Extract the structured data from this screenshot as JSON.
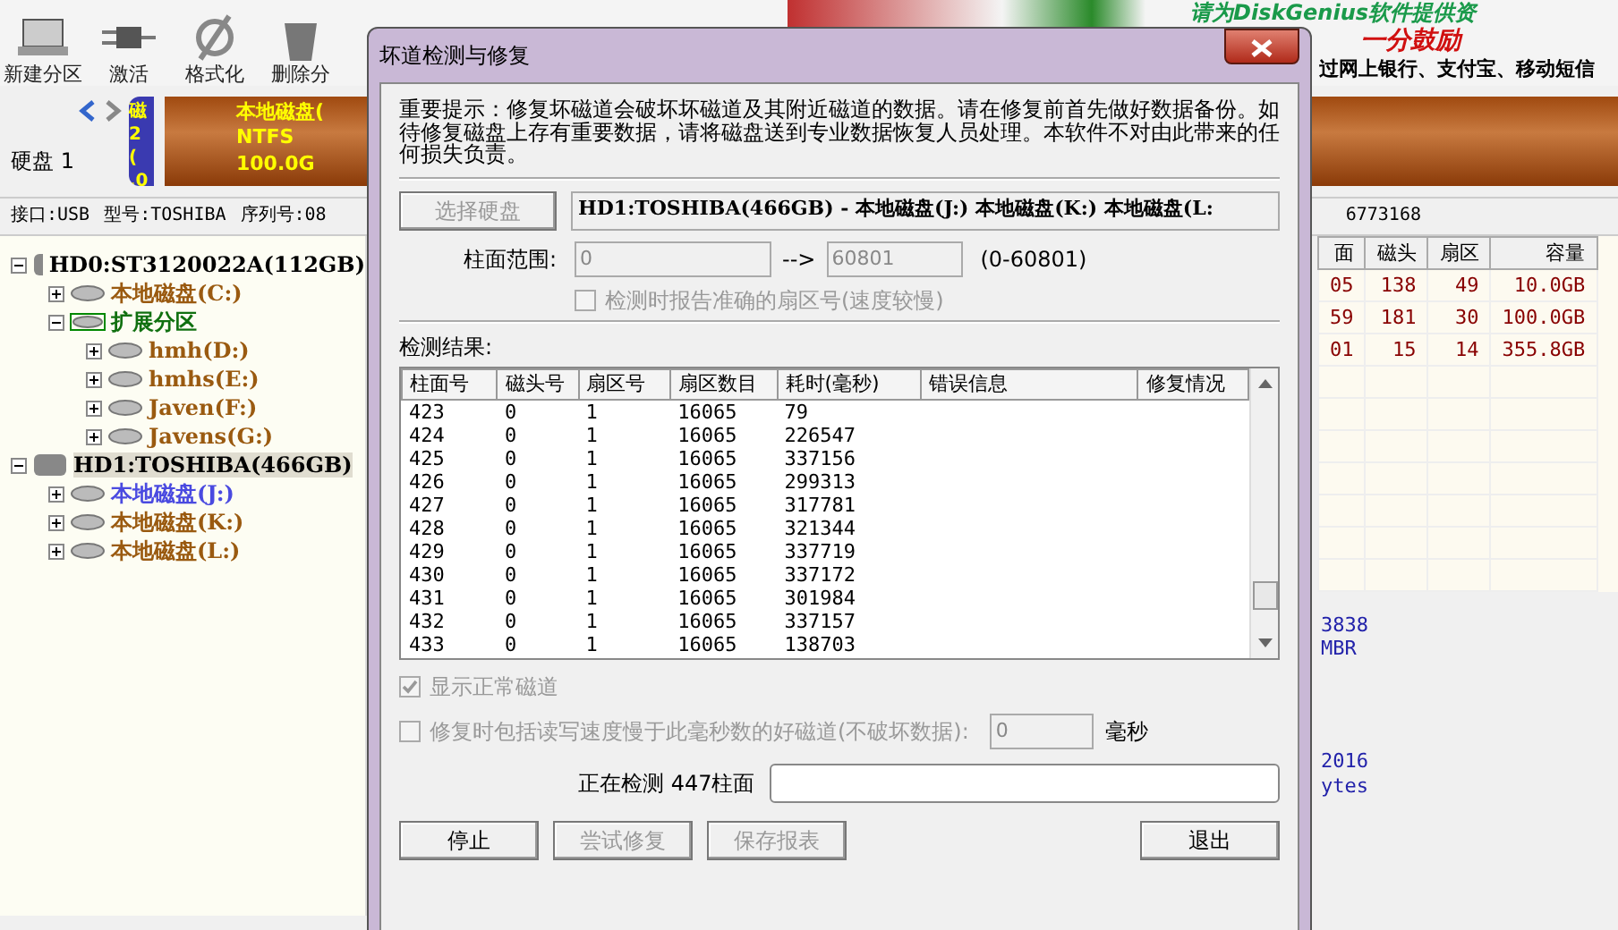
{
  "toolbar": {
    "buttons": [
      {
        "label": "新建分区"
      },
      {
        "label": "激活"
      },
      {
        "label": "格式化"
      },
      {
        "label": "删除分"
      }
    ]
  },
  "banner": {
    "line_1": "请为DiskGenius软件提供资",
    "line_2": "一分鼓励",
    "line_3": "过网上银行、支付宝、移动短信"
  },
  "disk_bar": {
    "disk_label": "硬盘 1",
    "small_partition": [
      "磁",
      "2 (",
      ".0"
    ],
    "partition": [
      "本地磁盘(",
      "NTFS",
      "100.0G"
    ]
  },
  "info_line": [
    "接口:USB",
    "型号:TOSHIBA",
    "序列号:08"
  ],
  "info_tail": "6773168",
  "tree": [
    {
      "label": "HD0:ST3120022A(112GB)",
      "kind": "disk",
      "selected": false,
      "expanded": true,
      "children": [
        {
          "label": "本地磁盘(C:)",
          "kind": "partition",
          "color": "#9a5a10",
          "selected": false,
          "expanded": false
        },
        {
          "label": "扩展分区",
          "kind": "extended",
          "color": "#107010",
          "selected": false,
          "expanded": true,
          "children": [
            {
              "label": "hmh(D:)",
              "kind": "partition",
              "color": "#9a5a10",
              "selected": false,
              "expanded": false
            },
            {
              "label": "hmhs(E:)",
              "kind": "partition",
              "color": "#9a5a10",
              "selected": false,
              "expanded": false
            },
            {
              "label": "Javen(F:)",
              "kind": "partition",
              "color": "#9a5a10",
              "selected": false,
              "expanded": false
            },
            {
              "label": "Javens(G:)",
              "kind": "partition",
              "color": "#9a5a10",
              "selected": false,
              "expanded": false
            }
          ]
        }
      ]
    },
    {
      "label": "HD1:TOSHIBA(466GB)",
      "kind": "disk",
      "selected": true,
      "expanded": true,
      "children": [
        {
          "label": "本地磁盘(J:)",
          "kind": "partition",
          "color": "#4a4ae0",
          "selected": false,
          "expanded": false
        },
        {
          "label": "本地磁盘(K:)",
          "kind": "partition",
          "color": "#9a5a10",
          "selected": false,
          "expanded": false
        },
        {
          "label": "本地磁盘(L:)",
          "kind": "partition",
          "color": "#9a5a10",
          "selected": false,
          "expanded": false
        }
      ]
    }
  ],
  "partition_table": {
    "columns": [
      "面",
      "磁头",
      "扇区",
      "容量"
    ],
    "rows": [
      [
        "05",
        "138",
        "49",
        "10.0GB"
      ],
      [
        "59",
        "181",
        "30",
        "100.0GB"
      ],
      [
        "01",
        "15",
        "14",
        "355.8GB"
      ]
    ]
  },
  "details": [
    "3838",
    "MBR",
    "2016",
    "ytes"
  ],
  "dialog": {
    "title": "坏道检测与修复",
    "notice": "重要提示：修复坏磁道会破坏坏磁道及其附近磁道的数据。请在修复前首先做好数据备份。如待修复磁盘上存有重要数据，请将磁盘送到专业数据恢复人员处理。本软件不对由此带来的任何损失负责。",
    "select_disk_button": "选择硬盘",
    "disk_name": "HD1:TOSHIBA(466GB) - 本地磁盘(J:) 本地磁盘(K:) 本地磁盘(L:",
    "range_label": "柱面范围:",
    "range_from": "0",
    "range_arrow": "-->",
    "range_to": "60801",
    "range_hint": "(0-60801)",
    "exact_sector": {
      "label": "检测时报告准确的扇区号(速度较慢)",
      "checked": false,
      "disabled": true
    },
    "results_label": "检测结果:",
    "columns": [
      "柱面号",
      "磁头号",
      "扇区号",
      "扇区数目",
      "耗时(毫秒)",
      "错误信息",
      "修复情况"
    ],
    "rows": [
      [
        "423",
        "0",
        "1",
        "16065",
        "79"
      ],
      [
        "424",
        "0",
        "1",
        "16065",
        "226547"
      ],
      [
        "425",
        "0",
        "1",
        "16065",
        "337156"
      ],
      [
        "426",
        "0",
        "1",
        "16065",
        "299313"
      ],
      [
        "427",
        "0",
        "1",
        "16065",
        "317781"
      ],
      [
        "428",
        "0",
        "1",
        "16065",
        "321344"
      ],
      [
        "429",
        "0",
        "1",
        "16065",
        "337719"
      ],
      [
        "430",
        "0",
        "1",
        "16065",
        "337172"
      ],
      [
        "431",
        "0",
        "1",
        "16065",
        "301984"
      ],
      [
        "432",
        "0",
        "1",
        "16065",
        "337157"
      ],
      [
        "433",
        "0",
        "1",
        "16065",
        "138703"
      ]
    ],
    "show_normal": {
      "label": "显示正常磁道",
      "checked": true,
      "disabled": true
    },
    "slow_tracks": {
      "label": "修复时包括读写速度慢于此毫秒数的好磁道(不破坏数据):",
      "checked": false,
      "disabled": true,
      "value": "0",
      "unit": "毫秒"
    },
    "progress_label": "正在检测 447柱面",
    "progress": {
      "level": 0
    },
    "buttons": [
      {
        "label": "停止",
        "disabled": false
      },
      {
        "label": "尝试修复",
        "disabled": true
      },
      {
        "label": "保存报表",
        "disabled": true
      },
      {
        "label": "退出",
        "disabled": false
      }
    ]
  }
}
